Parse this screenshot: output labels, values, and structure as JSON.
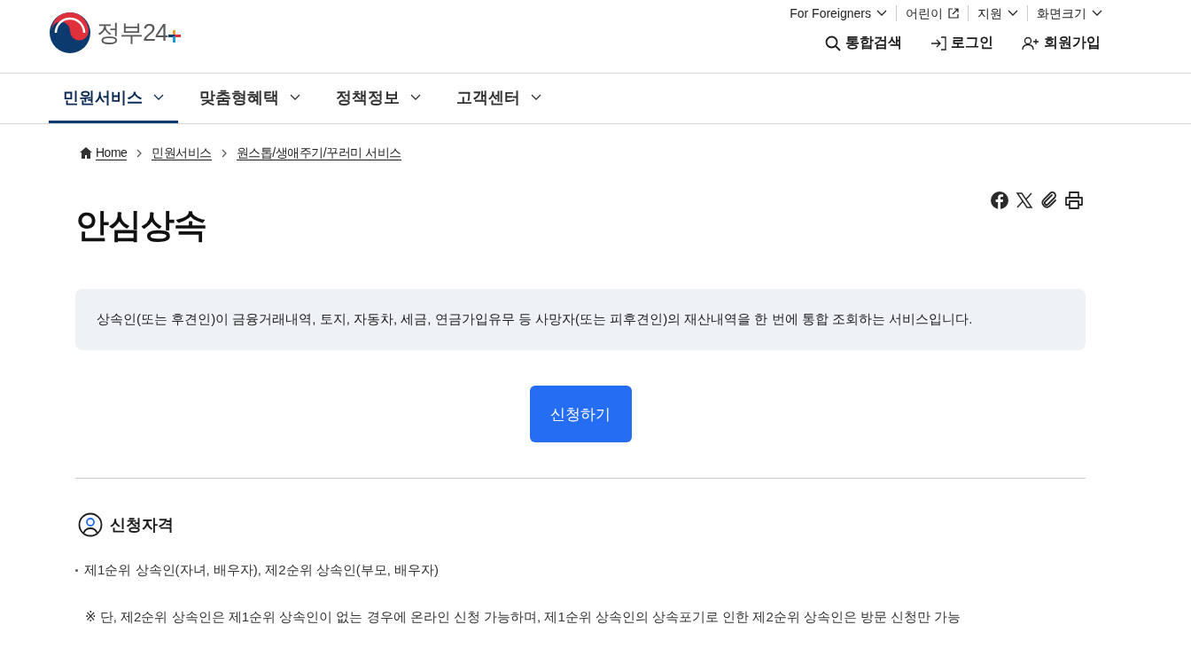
{
  "logo": {
    "text": "정부24"
  },
  "utility_links": [
    {
      "label": "For Foreigners",
      "kind": "dropdown"
    },
    {
      "label": "어린이",
      "kind": "external"
    },
    {
      "label": "지원",
      "kind": "dropdown"
    },
    {
      "label": "화면크기",
      "kind": "dropdown"
    }
  ],
  "header_actions": [
    {
      "label": "통합검색",
      "kind": "search"
    },
    {
      "label": "로그인",
      "kind": "login"
    },
    {
      "label": "회원가입",
      "kind": "signup"
    }
  ],
  "nav_tabs": [
    {
      "label": "민원서비스",
      "selected": true
    },
    {
      "label": "맞춤형혜택",
      "selected": false
    },
    {
      "label": "정책정보",
      "selected": false
    },
    {
      "label": "고객센터",
      "selected": false
    }
  ],
  "breadcrumb": [
    "Home",
    "민원서비스",
    "원스톱/생애주기/꾸러미 서비스"
  ],
  "title": "안심상속",
  "description": "상속인(또는 후견인)이 금융거래내역, 토지, 자동차, 세금, 연금가입유무 등 사망자(또는 피후견인)의 재산내역을 한 번에 통합 조회하는 서비스입니다.",
  "apply_button": "신청하기",
  "section": {
    "heading": "신청자격",
    "bullets": [
      "제1순위 상속인(자녀, 배우자), 제2순위 상속인(부모, 배우자)"
    ],
    "note": "※ 단, 제2순위 상속인은 제1순위 상속인이 없는 경우에 온라인 신청 가능하며, 제1순위 상속인의 상속포기로 인한 제2순위 상속인은 방문 신청만 가능"
  }
}
